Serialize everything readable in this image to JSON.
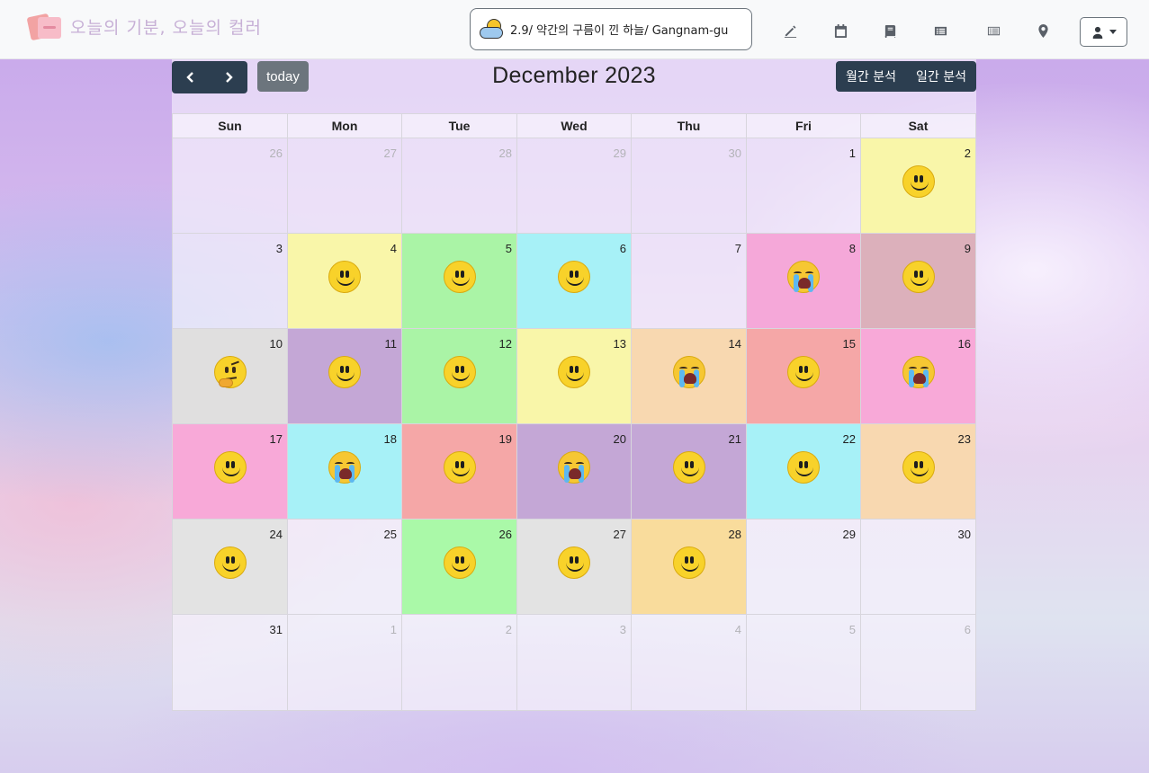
{
  "app": {
    "brand_text": "오늘의 기분, 오늘의 컬러",
    "weather_text": "2.9/ 약간의 구름이 낀 하늘/ Gangnam-gu"
  },
  "nav_icons": [
    "edit-icon",
    "calendar-icon",
    "book-icon",
    "list-icon",
    "list-alt-icon",
    "location-icon"
  ],
  "calendar": {
    "title": "December 2023",
    "today_label": "today",
    "prev_label": "previous month",
    "next_label": "next month",
    "monthly_analysis_label": "월간 분석",
    "daily_analysis_label": "일간 분석",
    "weekdays": [
      "Sun",
      "Mon",
      "Tue",
      "Wed",
      "Thu",
      "Fri",
      "Sat"
    ],
    "weeks": [
      [
        {
          "day": "26",
          "other": true,
          "color": "",
          "emoji": ""
        },
        {
          "day": "27",
          "other": true,
          "color": "",
          "emoji": ""
        },
        {
          "day": "28",
          "other": true,
          "color": "",
          "emoji": ""
        },
        {
          "day": "29",
          "other": true,
          "color": "",
          "emoji": ""
        },
        {
          "day": "30",
          "other": true,
          "color": "",
          "emoji": ""
        },
        {
          "day": "1",
          "other": false,
          "color": "",
          "emoji": ""
        },
        {
          "day": "2",
          "other": false,
          "color": "#f9f6a9",
          "emoji": "smile"
        }
      ],
      [
        {
          "day": "3",
          "other": false,
          "color": "",
          "emoji": ""
        },
        {
          "day": "4",
          "other": false,
          "color": "#f9f6a9",
          "emoji": "smile"
        },
        {
          "day": "5",
          "other": false,
          "color": "#aaf4a6",
          "emoji": "smile"
        },
        {
          "day": "6",
          "other": false,
          "color": "#a7f1f7",
          "emoji": "smile"
        },
        {
          "day": "7",
          "other": false,
          "color": "",
          "emoji": ""
        },
        {
          "day": "8",
          "other": false,
          "color": "#f5a8d9",
          "emoji": "cry"
        },
        {
          "day": "9",
          "other": false,
          "color": "#dcb0bb",
          "emoji": "smile"
        }
      ],
      [
        {
          "day": "10",
          "other": false,
          "color": "#e0dfdf",
          "emoji": "think"
        },
        {
          "day": "11",
          "other": false,
          "color": "#c4a7d6",
          "emoji": "smile"
        },
        {
          "day": "12",
          "other": false,
          "color": "#aaf4a6",
          "emoji": "smile"
        },
        {
          "day": "13",
          "other": false,
          "color": "#f9f6a9",
          "emoji": "smile"
        },
        {
          "day": "14",
          "other": false,
          "color": "#f8d8b0",
          "emoji": "cry"
        },
        {
          "day": "15",
          "other": false,
          "color": "#f5a7a7",
          "emoji": "smile"
        },
        {
          "day": "16",
          "other": false,
          "color": "#f8a9d8",
          "emoji": "cry"
        }
      ],
      [
        {
          "day": "17",
          "other": false,
          "color": "#f8a9d8",
          "emoji": "smile"
        },
        {
          "day": "18",
          "other": false,
          "color": "#a7f1f7",
          "emoji": "cry"
        },
        {
          "day": "19",
          "other": false,
          "color": "#f5a7a7",
          "emoji": "smile"
        },
        {
          "day": "20",
          "other": false,
          "color": "#c4a7d6",
          "emoji": "cry"
        },
        {
          "day": "21",
          "other": false,
          "color": "#c4a7d6",
          "emoji": "smile"
        },
        {
          "day": "22",
          "other": false,
          "color": "#a7f1f7",
          "emoji": "smile"
        },
        {
          "day": "23",
          "other": false,
          "color": "#f8d8b0",
          "emoji": "smile"
        }
      ],
      [
        {
          "day": "24",
          "other": false,
          "color": "#e3e3e3",
          "emoji": "smile"
        },
        {
          "day": "25",
          "other": false,
          "color": "",
          "emoji": ""
        },
        {
          "day": "26",
          "other": false,
          "color": "#aaf9a8",
          "emoji": "smile"
        },
        {
          "day": "27",
          "other": false,
          "color": "#e3e3e3",
          "emoji": "smile"
        },
        {
          "day": "28",
          "other": false,
          "color": "#f9dc9c",
          "emoji": "smile"
        },
        {
          "day": "29",
          "other": false,
          "color": "",
          "emoji": ""
        },
        {
          "day": "30",
          "other": false,
          "color": "",
          "emoji": ""
        }
      ],
      [
        {
          "day": "31",
          "other": false,
          "color": "",
          "emoji": ""
        },
        {
          "day": "1",
          "other": true,
          "color": "",
          "emoji": ""
        },
        {
          "day": "2",
          "other": true,
          "color": "",
          "emoji": ""
        },
        {
          "day": "3",
          "other": true,
          "color": "",
          "emoji": ""
        },
        {
          "day": "4",
          "other": true,
          "color": "",
          "emoji": ""
        },
        {
          "day": "5",
          "other": true,
          "color": "",
          "emoji": ""
        },
        {
          "day": "6",
          "other": true,
          "color": "",
          "emoji": ""
        }
      ]
    ]
  }
}
